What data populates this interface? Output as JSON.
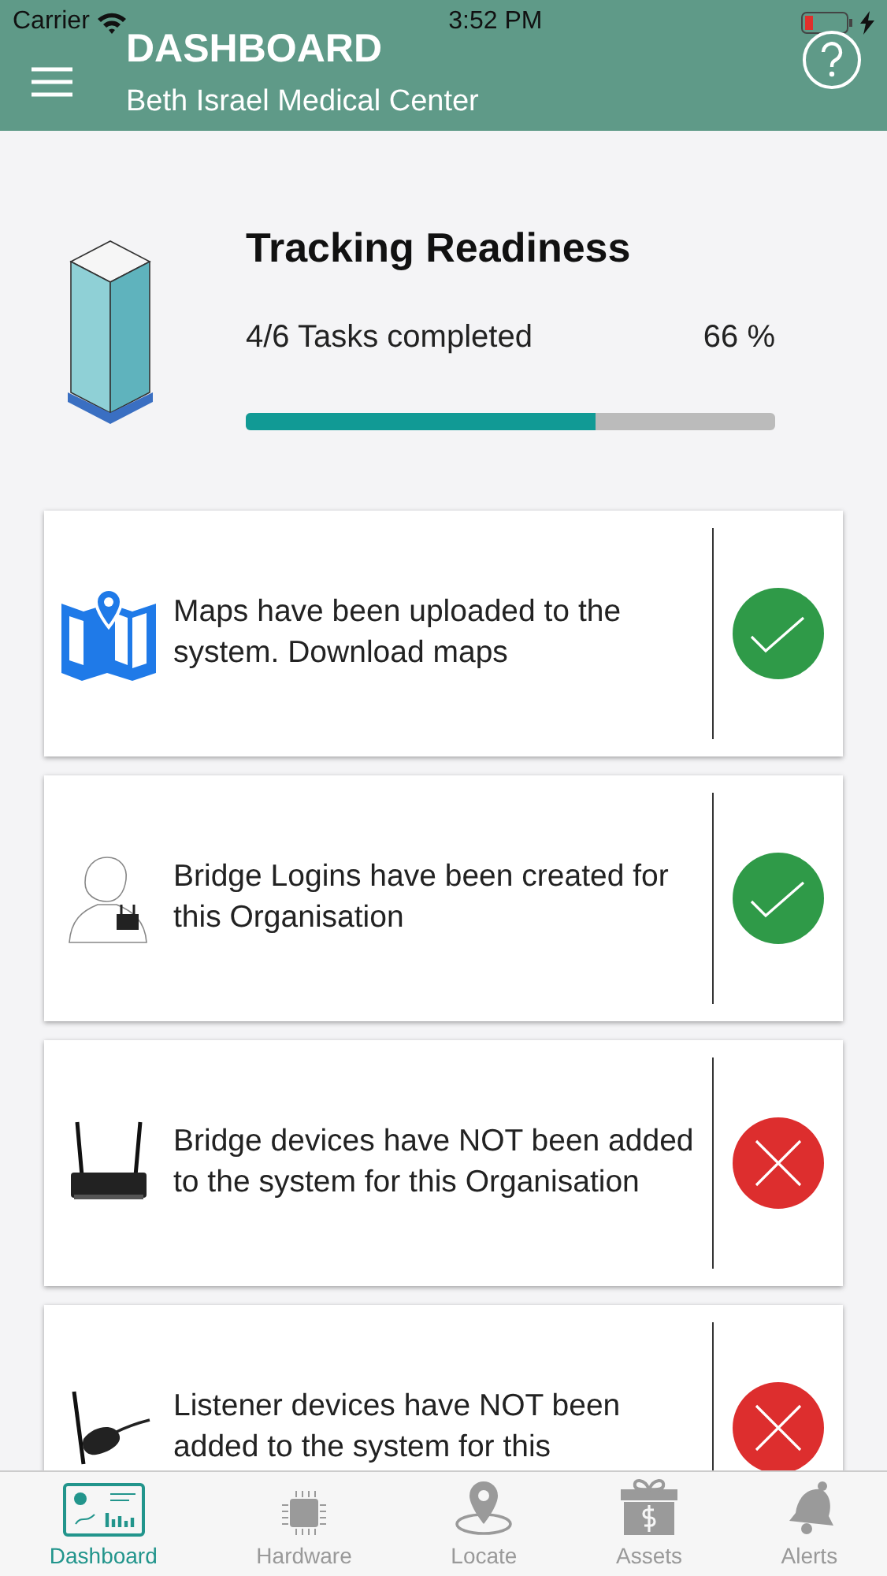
{
  "status_bar": {
    "carrier": "Carrier",
    "time": "3:52 PM"
  },
  "header": {
    "title": "DASHBOARD",
    "subtitle": "Beth Israel Medical Center"
  },
  "readiness": {
    "title": "Tracking Readiness",
    "tasks": "4/6 Tasks completed",
    "percent": "66 %",
    "level": 0.66
  },
  "tasks": [
    {
      "kind": "map",
      "text": "Maps have been uploaded to the system. Download maps",
      "done": true
    },
    {
      "kind": "login",
      "text": "Bridge Logins have been created for this Organisation",
      "done": true
    },
    {
      "kind": "bridge",
      "text": "Bridge devices have NOT been added to the system for this Organisation",
      "done": false
    },
    {
      "kind": "listener",
      "text": "Listener devices have NOT been added to the system for this",
      "done": false
    }
  ],
  "tab_bar": [
    {
      "kind": "dashboard",
      "label": "Dashboard",
      "selected": true
    },
    {
      "kind": "hardware",
      "label": "Hardware",
      "selected": false
    },
    {
      "kind": "locate",
      "label": "Locate",
      "selected": false
    },
    {
      "kind": "assets",
      "label": "Assets",
      "selected": false
    },
    {
      "kind": "alerts",
      "label": "Alerts",
      "selected": false
    }
  ]
}
